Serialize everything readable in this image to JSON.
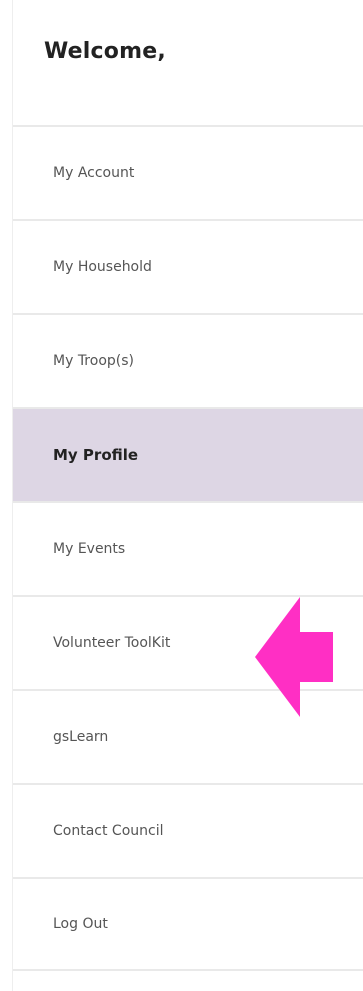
{
  "welcome": {
    "title": "Welcome,"
  },
  "nav": {
    "items": [
      {
        "label": "My Account",
        "active": false
      },
      {
        "label": "My Household",
        "active": false
      },
      {
        "label": "My Troop(s)",
        "active": false
      },
      {
        "label": "My Profile",
        "active": true
      },
      {
        "label": "My Events",
        "active": false
      },
      {
        "label": "Volunteer ToolKit",
        "active": false
      },
      {
        "label": "gsLearn",
        "active": false
      },
      {
        "label": "Contact Council",
        "active": false
      },
      {
        "label": "Log Out",
        "active": false
      }
    ]
  },
  "annotation": {
    "icon": "pink-left-arrow-icon",
    "color": "#ff2fc4"
  },
  "colors": {
    "active_bg": "#ddd6e4",
    "divider": "#e9e9e9",
    "text": "#555555",
    "heading": "#222222"
  }
}
